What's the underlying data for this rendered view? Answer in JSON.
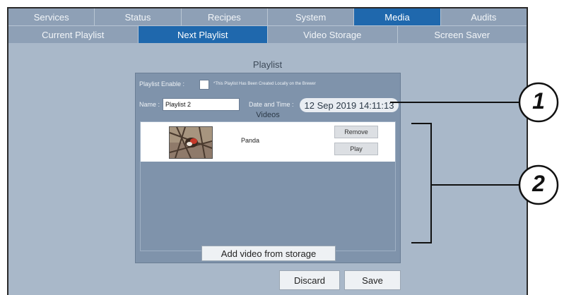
{
  "tabs_top": [
    "Services",
    "Status",
    "Recipes",
    "System",
    "Media",
    "Audits"
  ],
  "tabs_sub": [
    "Current Playlist",
    "Next Playlist",
    "Video Storage",
    "Screen Saver"
  ],
  "page_title": "Playlist",
  "form": {
    "enable_label": "Playlist Enable :",
    "enable_checked": false,
    "local_note": "*This Playlist Has Been Created Locally on the Brewer",
    "name_label": "Name :",
    "name_value": "Playlist 2",
    "datetime_label": "Date and Time :",
    "datetime_value": "12 Sep 2019 14:11:13"
  },
  "videos": {
    "label": "Videos",
    "items": [
      {
        "name": "Panda",
        "remove_label": "Remove",
        "play_label": "Play"
      }
    ]
  },
  "add_video_label": "Add video from storage",
  "discard_label": "Discard",
  "save_label": "Save",
  "callouts": [
    "1",
    "2"
  ],
  "colors": {
    "active_tab": "#1f68ad",
    "background": "#a9b8c9",
    "panel": "#7f93ab"
  }
}
